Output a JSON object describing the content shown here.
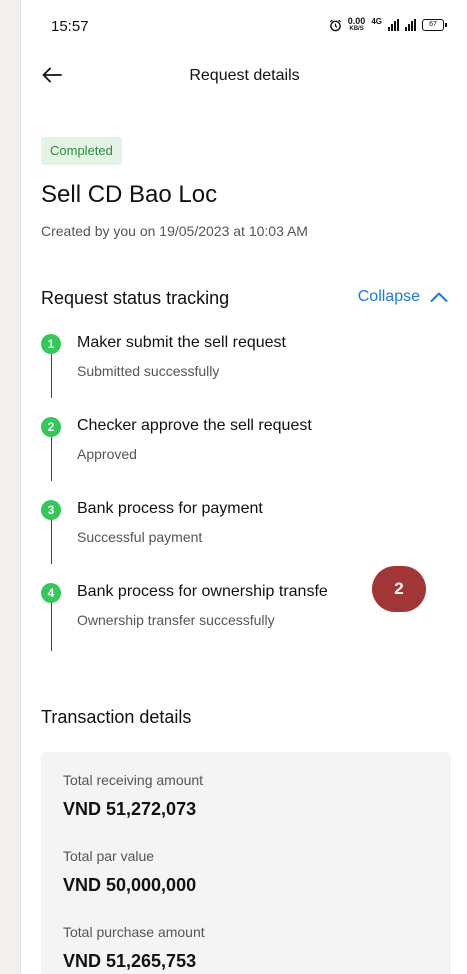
{
  "status_bar": {
    "time": "15:57",
    "net_speed_value": "0.00",
    "net_speed_unit": "KB/S",
    "network_label": "4G",
    "battery": "67"
  },
  "header": {
    "title": "Request details"
  },
  "request": {
    "status_badge": "Completed",
    "name": "Sell CD Bao Loc",
    "created": "Created by you on 19/05/2023 at 10:03 AM"
  },
  "tracking": {
    "title": "Request status tracking",
    "collapse_label": "Collapse",
    "steps": [
      {
        "number": "1",
        "title": "Maker submit the sell request",
        "subtitle": "Submitted successfully"
      },
      {
        "number": "2",
        "title": "Checker approve the sell request",
        "subtitle": "Approved"
      },
      {
        "number": "3",
        "title": "Bank process for payment",
        "subtitle": "Successful payment"
      },
      {
        "number": "4",
        "title": "Bank process for ownership transfe",
        "subtitle": "Ownership transfer successfully"
      }
    ]
  },
  "annotation": {
    "label": "2"
  },
  "transaction": {
    "title": "Transaction details",
    "items": [
      {
        "label": "Total receiving amount",
        "value": "VND 51,272,073"
      },
      {
        "label": "Total par value",
        "value": "VND 50,000,000"
      },
      {
        "label": "Total purchase amount",
        "value": "VND 51,265,753"
      }
    ]
  },
  "colors": {
    "accent": "#1b7ae0",
    "step_green": "#34c759",
    "badge_bg": "#e3f4e6",
    "badge_text": "#2e8b3a",
    "annotation": "#a23535"
  }
}
